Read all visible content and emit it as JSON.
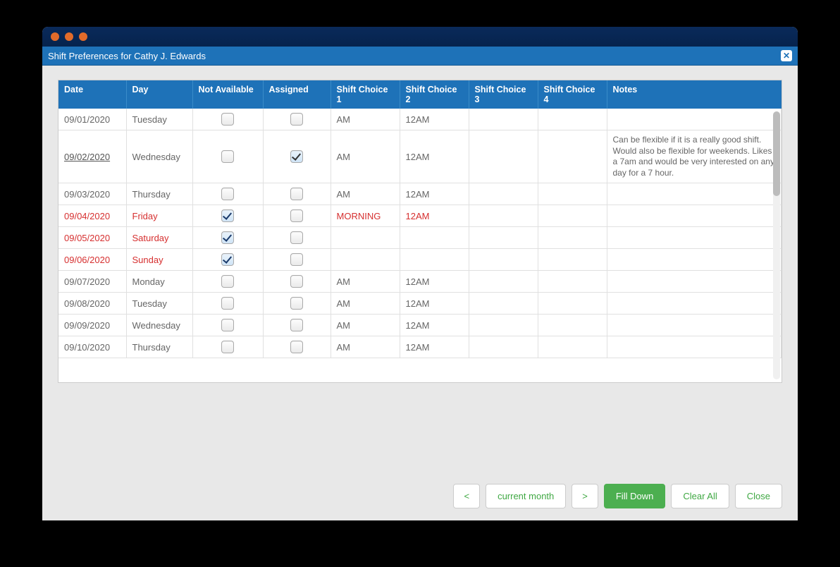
{
  "colors": {
    "macDots": [
      "#e26b2a",
      "#e26b2a",
      "#e26b2a"
    ]
  },
  "dialog": {
    "title": "Shift Preferences for Cathy J. Edwards"
  },
  "table": {
    "headers": {
      "date": "Date",
      "day": "Day",
      "notAvailable": "Not Available",
      "assigned": "Assigned",
      "choice1": "Shift Choice 1",
      "choice2": "Shift Choice 2",
      "choice3": "Shift Choice 3",
      "choice4": "Shift Choice 4",
      "notes": "Notes"
    },
    "rows": [
      {
        "date": "09/01/2020",
        "day": "Tuesday",
        "notAvailable": false,
        "assigned": false,
        "choice1": "AM",
        "choice2": "12AM",
        "choice3": "",
        "choice4": "",
        "notes": "",
        "red": false,
        "link": false
      },
      {
        "date": "09/02/2020",
        "day": "Wednesday",
        "notAvailable": false,
        "assigned": true,
        "choice1": "AM",
        "choice2": "12AM",
        "choice3": "",
        "choice4": "",
        "notes": "Can be flexible if it is a really good shift. Would also be flexible for weekends. Likes a 7am and would be very interested on any day for a 7 hour.",
        "red": false,
        "link": true
      },
      {
        "date": "09/03/2020",
        "day": "Thursday",
        "notAvailable": false,
        "assigned": false,
        "choice1": "AM",
        "choice2": "12AM",
        "choice3": "",
        "choice4": "",
        "notes": "",
        "red": false,
        "link": false
      },
      {
        "date": "09/04/2020",
        "day": "Friday",
        "notAvailable": true,
        "assigned": false,
        "choice1": "MORNING",
        "choice2": "12AM",
        "choice3": "",
        "choice4": "",
        "notes": "",
        "red": true,
        "link": false
      },
      {
        "date": "09/05/2020",
        "day": "Saturday",
        "notAvailable": true,
        "assigned": false,
        "choice1": "",
        "choice2": "",
        "choice3": "",
        "choice4": "",
        "notes": "",
        "red": true,
        "link": false
      },
      {
        "date": "09/06/2020",
        "day": "Sunday",
        "notAvailable": true,
        "assigned": false,
        "choice1": "",
        "choice2": "",
        "choice3": "",
        "choice4": "",
        "notes": "",
        "red": true,
        "link": false
      },
      {
        "date": "09/07/2020",
        "day": "Monday",
        "notAvailable": false,
        "assigned": false,
        "choice1": "AM",
        "choice2": "12AM",
        "choice3": "",
        "choice4": "",
        "notes": "",
        "red": false,
        "link": false
      },
      {
        "date": "09/08/2020",
        "day": "Tuesday",
        "notAvailable": false,
        "assigned": false,
        "choice1": "AM",
        "choice2": "12AM",
        "choice3": "",
        "choice4": "",
        "notes": "",
        "red": false,
        "link": false
      },
      {
        "date": "09/09/2020",
        "day": "Wednesday",
        "notAvailable": false,
        "assigned": false,
        "choice1": "AM",
        "choice2": "12AM",
        "choice3": "",
        "choice4": "",
        "notes": "",
        "red": false,
        "link": false
      },
      {
        "date": "09/10/2020",
        "day": "Thursday",
        "notAvailable": false,
        "assigned": false,
        "choice1": "AM",
        "choice2": "12AM",
        "choice3": "",
        "choice4": "",
        "notes": "",
        "red": false,
        "link": false
      }
    ]
  },
  "buttons": {
    "prev": "<",
    "currentMonth": "current month",
    "next": ">",
    "fillDown": "Fill Down",
    "clearAll": "Clear All",
    "close": "Close"
  }
}
